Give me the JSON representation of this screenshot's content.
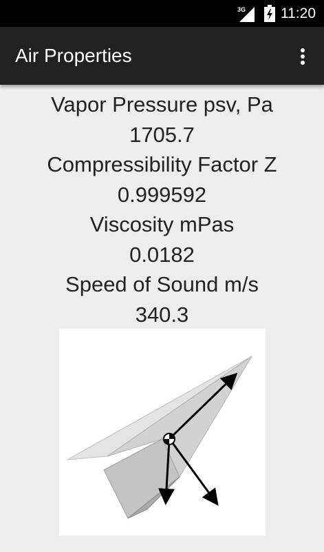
{
  "status_bar": {
    "network_label": "3G",
    "signal_icon": "signal-strength-icon",
    "battery_icon": "battery-charging-icon",
    "time": "11:20"
  },
  "app_bar": {
    "title": "Air Properties",
    "overflow_icon": "more-vert-icon"
  },
  "properties": [
    {
      "label": "Vapor Pressure psv, Pa",
      "value": "1705.7"
    },
    {
      "label": "Compressibility Factor Z",
      "value": "0.999592"
    },
    {
      "label": "Viscosity mPas",
      "value": "0.0182"
    },
    {
      "label": "Speed of Sound m/s",
      "value": "340.3"
    }
  ],
  "illustration": {
    "icon": "paper-airplane-forces-icon"
  },
  "colors": {
    "status_bar": "#000000",
    "app_bar": "#212121",
    "background": "#eeeeee",
    "text": "#222222"
  }
}
